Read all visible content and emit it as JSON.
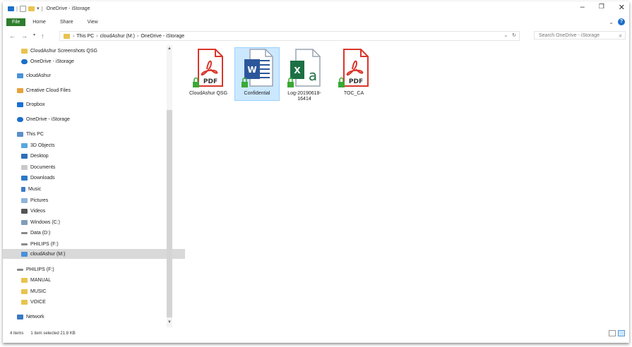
{
  "window": {
    "title": "OneDrive - iStorage"
  },
  "ribbon": {
    "tabs": [
      "File",
      "Home",
      "Share",
      "View"
    ]
  },
  "address": {
    "crumbs": [
      "This PC",
      "cloudAshur (M:)",
      "OneDrive - iStorage"
    ],
    "search_placeholder": "Search OneDrive - iStorage"
  },
  "sidebar": {
    "items": [
      {
        "label": "CloudAshur Screenshots QSG",
        "icon": "folder-icon"
      },
      {
        "label": "OneDrive - iStorage",
        "icon": "onedrive-icon"
      },
      {
        "label": "cloudAshur",
        "icon": "drive-icon"
      },
      {
        "label": "Creative Cloud Files",
        "icon": "creative-cloud-icon"
      },
      {
        "label": "Dropbox",
        "icon": "dropbox-icon"
      },
      {
        "label": "OneDrive - iStorage",
        "icon": "onedrive-icon"
      },
      {
        "label": "This PC",
        "icon": "pc-icon"
      },
      {
        "label": "3D Objects",
        "icon": "3d-objects-icon"
      },
      {
        "label": "Desktop",
        "icon": "desktop-icon"
      },
      {
        "label": "Documents",
        "icon": "documents-icon"
      },
      {
        "label": "Downloads",
        "icon": "downloads-icon"
      },
      {
        "label": "Music",
        "icon": "music-icon"
      },
      {
        "label": "Pictures",
        "icon": "pictures-icon"
      },
      {
        "label": "Videos",
        "icon": "videos-icon"
      },
      {
        "label": "Windows (C:)",
        "icon": "windows-drive-icon"
      },
      {
        "label": "Data (D:)",
        "icon": "drive-icon"
      },
      {
        "label": "PHILIPS (F:)",
        "icon": "usb-drive-icon"
      },
      {
        "label": "cloudAshur (M:)",
        "icon": "drive-icon"
      },
      {
        "label": "PHILIPS (F:)",
        "icon": "usb-drive-icon"
      },
      {
        "label": "MANUAL",
        "icon": "folder-icon"
      },
      {
        "label": "MUSIC",
        "icon": "folder-icon"
      },
      {
        "label": "VOICE",
        "icon": "folder-icon"
      },
      {
        "label": "Network",
        "icon": "network-icon"
      }
    ]
  },
  "files": [
    {
      "name": "CloudAshur QSG",
      "type": "pdf",
      "badge": "PDF"
    },
    {
      "name": "Confidential",
      "type": "word",
      "badge": "W"
    },
    {
      "name": "Log-20190618-16414",
      "type": "excel",
      "badge": "X"
    },
    {
      "name": "TOC_CA",
      "type": "pdf",
      "badge": "PDF"
    }
  ],
  "status": {
    "items": "4 items",
    "selected": "1 item selected  21.8 KB"
  },
  "colors": {
    "pdf": "#d9362b",
    "word": "#2b579a",
    "excel": "#1d7044",
    "lock": "#3aa935",
    "selection": "#cce8ff",
    "file_tab": "#2d7d2d"
  }
}
